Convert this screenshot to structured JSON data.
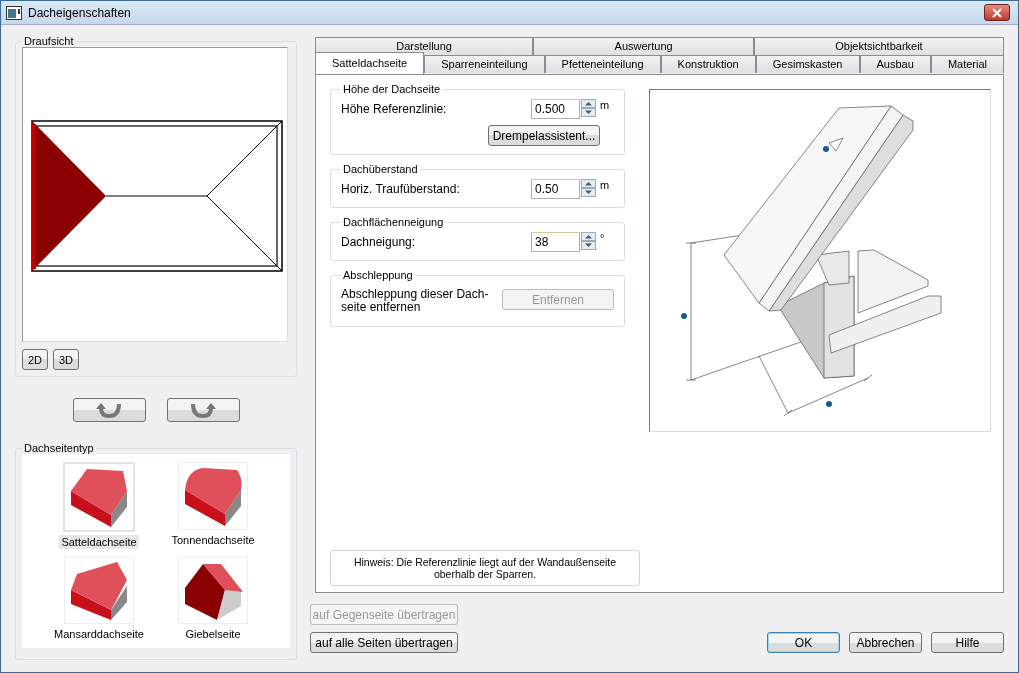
{
  "window": {
    "title": "Dacheigenschaften"
  },
  "top_view": {
    "title": "Draufsicht",
    "view_buttons": [
      {
        "label": "2D"
      },
      {
        "label": "3D"
      }
    ]
  },
  "roof_side_type": {
    "title": "Dachseitentyp",
    "items": [
      {
        "label": "Satteldachseite",
        "kind": "gable",
        "selected": true
      },
      {
        "label": "Tonnendachseite",
        "kind": "barrel",
        "selected": false
      },
      {
        "label": "Mansarddachseite",
        "kind": "mansard",
        "selected": false
      },
      {
        "label": "Giebelseite",
        "kind": "gable_end",
        "selected": false
      }
    ]
  },
  "tabs": [
    [
      {
        "label": "Darstellung",
        "selected": false
      },
      {
        "label": "Auswertung",
        "selected": false
      },
      {
        "label": "Objektsichtbarkeit",
        "selected": false
      }
    ],
    [
      {
        "label": "Satteldachseite",
        "selected": true
      },
      {
        "label": "Sparreneinteilung",
        "selected": false
      },
      {
        "label": "Pfetteneinteilung",
        "selected": false
      },
      {
        "label": "Konstruktion",
        "selected": false
      },
      {
        "label": "Gesimskasten",
        "selected": false
      },
      {
        "label": "Ausbau",
        "selected": false
      },
      {
        "label": "Material",
        "selected": false
      }
    ]
  ],
  "groups": [
    {
      "title": "Höhe der Dachseite",
      "kind": "field",
      "label": "Höhe Referenzlinie:",
      "value": "0.500",
      "unit": "m",
      "button": {
        "label": "Drempelassistent...",
        "disabled": false
      }
    },
    {
      "title": "Dachüberstand",
      "kind": "field",
      "label": "Horiz. Traufüberstand:",
      "value": "0.50",
      "unit": "m"
    },
    {
      "title": "Dachflächenneigung",
      "kind": "field",
      "label": "Dachneigung:",
      "value": "38",
      "unit": "°"
    },
    {
      "title": "Abschleppung",
      "kind": "action",
      "label": "Abschleppung dieser Dach-\nseite entfernen",
      "button": {
        "label": "Entfernen",
        "disabled": true
      }
    }
  ],
  "note": "Hinweis: Die Referenzlinie liegt auf der Wandaußenseite oberhalb der Sparren.",
  "left_buttons": [
    {
      "label": "auf Gegenseite übertragen",
      "disabled": true
    },
    {
      "label": "auf alle Seiten übertragen",
      "disabled": false
    }
  ],
  "right_buttons": [
    {
      "label": "OK",
      "default": true
    },
    {
      "label": "Abbrechen",
      "default": false
    },
    {
      "label": "Hilfe",
      "default": false
    }
  ]
}
